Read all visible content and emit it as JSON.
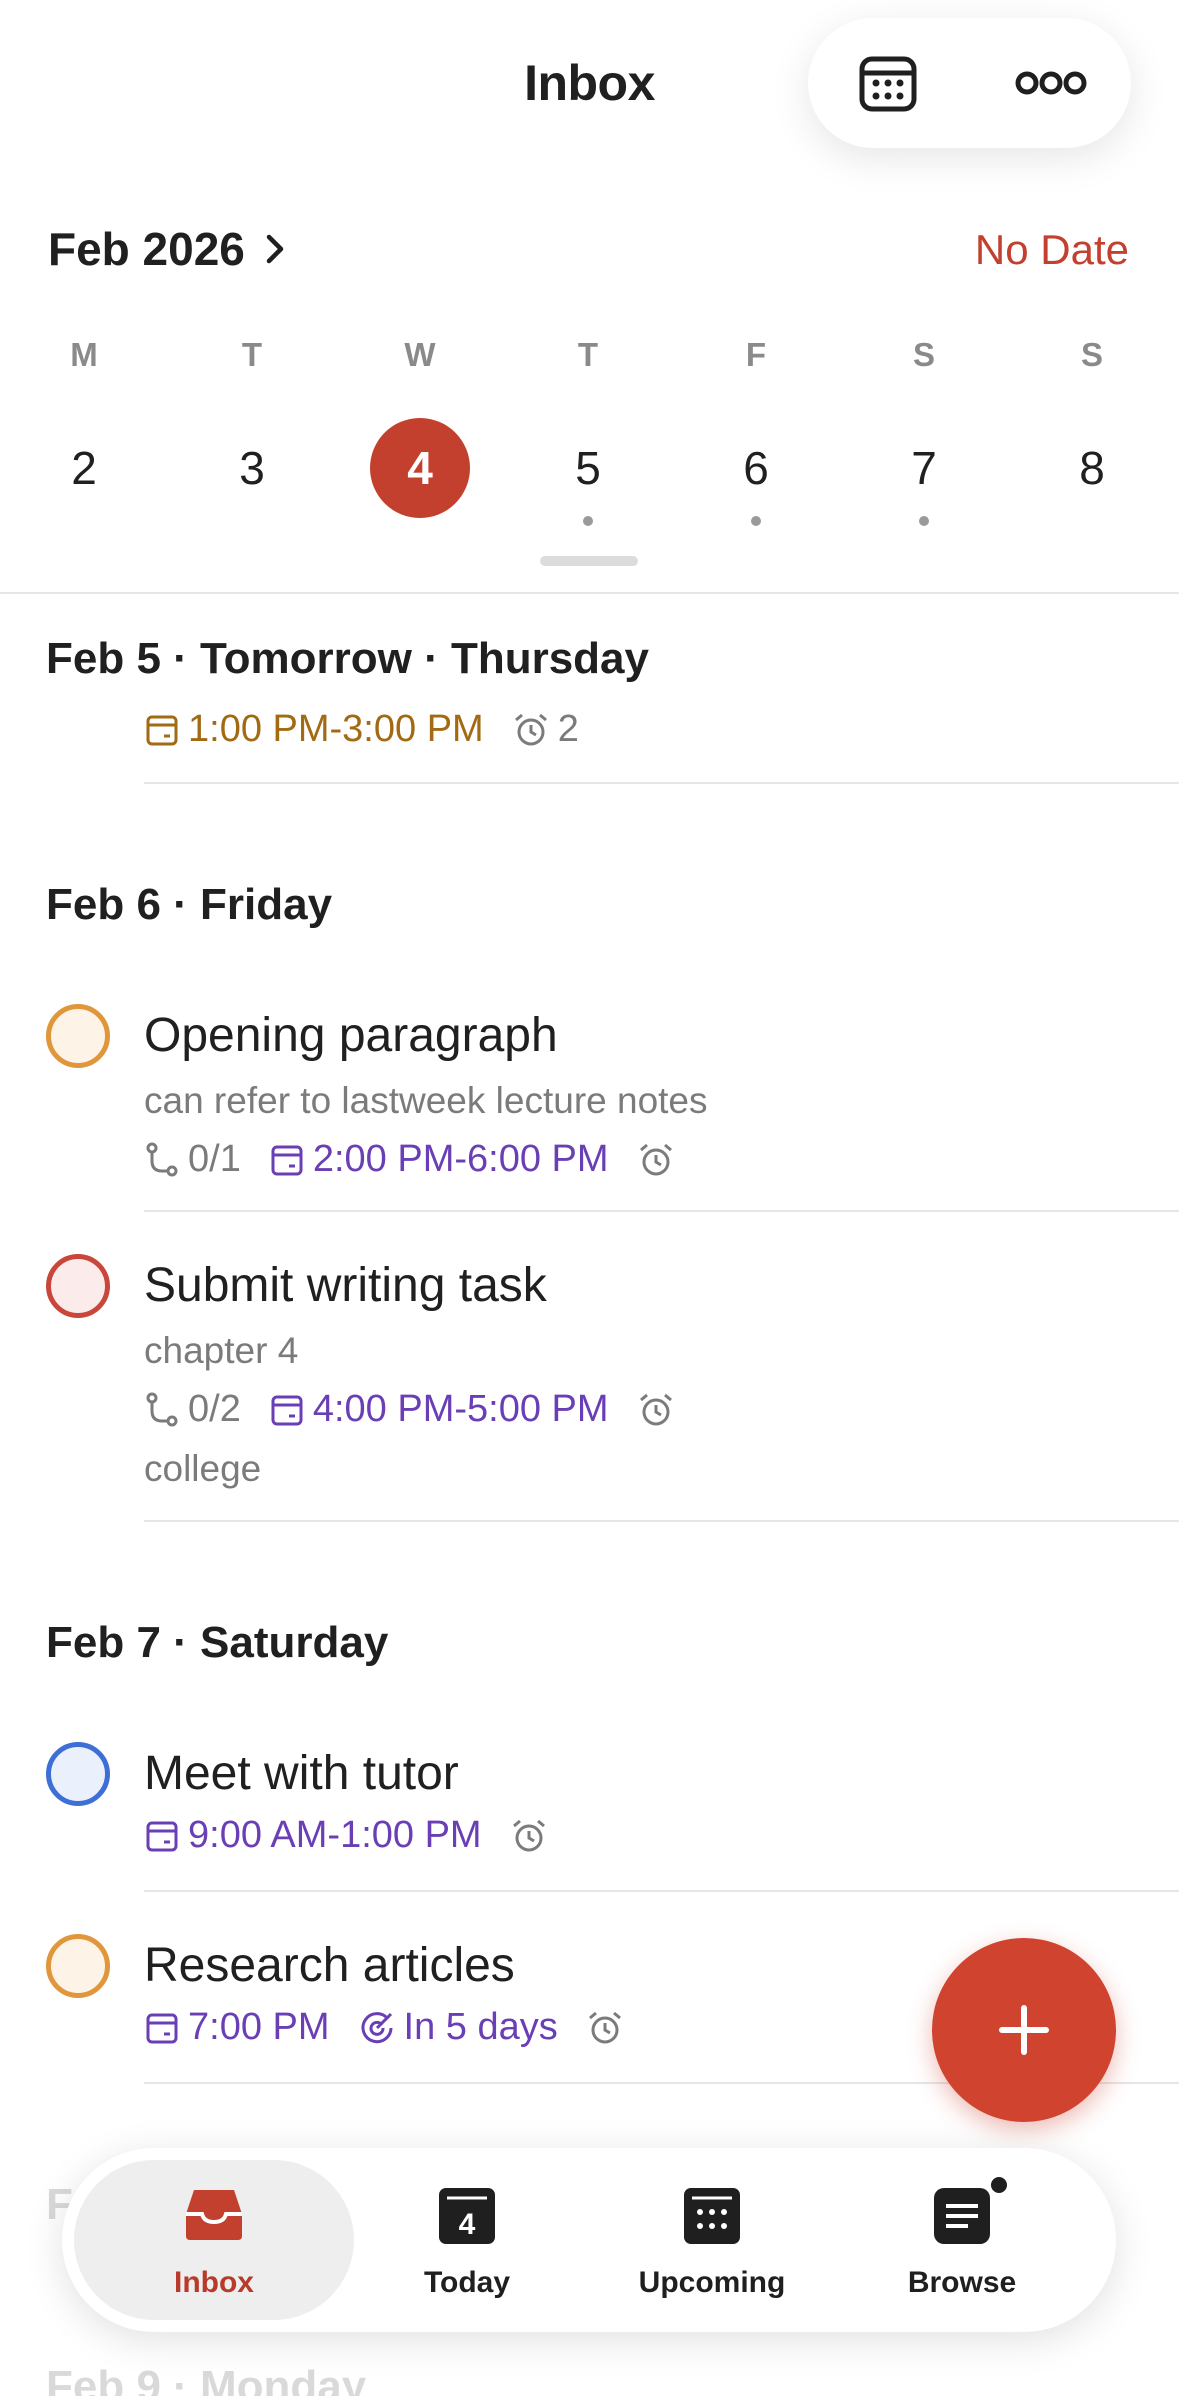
{
  "header": {
    "title": "Inbox",
    "calendar_icon": "calendar-grid-icon",
    "more_icon": "more-horizontal-icon"
  },
  "calendar": {
    "month_label": "Feb 2026",
    "no_date_label": "No Date",
    "days": [
      {
        "letter": "M",
        "num": "2",
        "selected": false,
        "dot": false
      },
      {
        "letter": "T",
        "num": "3",
        "selected": false,
        "dot": false
      },
      {
        "letter": "W",
        "num": "4",
        "selected": true,
        "dot": false
      },
      {
        "letter": "T",
        "num": "5",
        "selected": false,
        "dot": true
      },
      {
        "letter": "F",
        "num": "6",
        "selected": false,
        "dot": true
      },
      {
        "letter": "S",
        "num": "7",
        "selected": false,
        "dot": true
      },
      {
        "letter": "S",
        "num": "8",
        "selected": false,
        "dot": false
      }
    ]
  },
  "sections": {
    "feb5": {
      "title": "Feb 5 · Tomorrow · Thursday",
      "partial_task": {
        "time": "1:00 PM-3:00 PM",
        "reminders": "2"
      }
    },
    "feb6": {
      "title": "Feb 6 · Friday",
      "tasks": [
        {
          "title": "Opening paragraph",
          "desc": "can refer to lastweek lecture notes",
          "subtasks": "0/1",
          "time": "2:00 PM-6:00 PM",
          "priority_color": "#e0963a"
        },
        {
          "title": "Submit writing task",
          "desc": "chapter 4",
          "subtasks": "0/2",
          "time": "4:00 PM-5:00 PM",
          "label": "college",
          "priority_color": "#c8463a"
        }
      ]
    },
    "feb7": {
      "title": "Feb 7 · Saturday",
      "tasks": [
        {
          "title": "Meet with tutor",
          "time": "9:00 AM-1:00 PM",
          "priority_color": "#3d6fd6"
        },
        {
          "title": "Research articles",
          "time": "7:00 PM",
          "deadline": "In 5 days",
          "priority_color": "#e0963a"
        }
      ]
    },
    "next_faded": {
      "title_start": "F",
      "title_after": "Feb 9 · Monday"
    }
  },
  "nav": {
    "items": [
      {
        "label": "Inbox",
        "active": true
      },
      {
        "label": "Today",
        "icon_num": "4"
      },
      {
        "label": "Upcoming"
      },
      {
        "label": "Browse"
      }
    ]
  },
  "colors": {
    "accent": "#c3402e",
    "purple": "#6a3fb6"
  }
}
